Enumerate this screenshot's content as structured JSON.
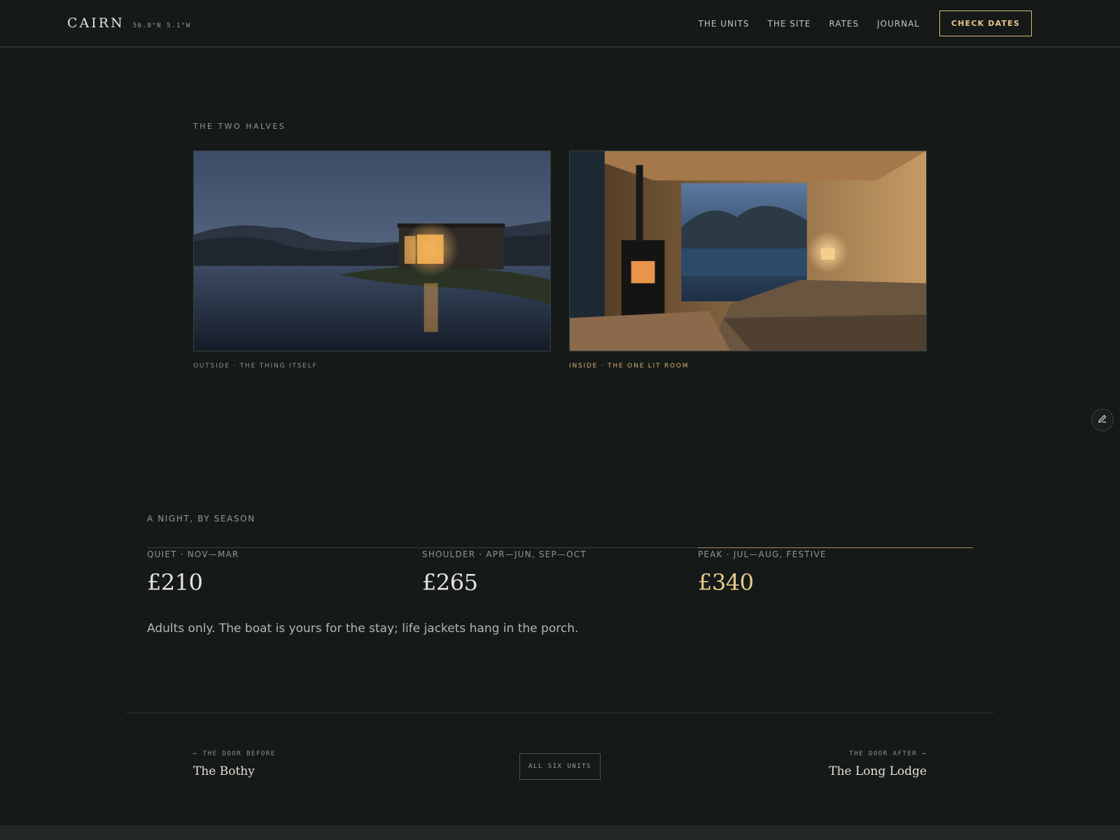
{
  "header": {
    "brand": "CAIRN",
    "coords": "56.8°N 5.1°W",
    "nav": [
      "THE UNITS",
      "THE SITE",
      "RATES",
      "JOURNAL"
    ],
    "cta": "CHECK DATES"
  },
  "halves": {
    "eyebrow": "THE TWO HALVES",
    "outside_caption": "OUTSIDE · THE THING ITSELF",
    "inside_caption": "INSIDE · THE ONE LIT ROOM"
  },
  "rates": {
    "eyebrow": "A NIGHT, BY SEASON",
    "seasons": [
      {
        "label": "QUIET · NOV—MAR",
        "price": "£210"
      },
      {
        "label": "SHOULDER · APR—JUN, SEP—OCT",
        "price": "£265"
      },
      {
        "label": "PEAK · JUL—AUG, FESTIVE",
        "price": "£340"
      }
    ],
    "note": "Adults only. The boat is yours for the stay; life jackets hang in the porch."
  },
  "pager": {
    "prev_label": "← THE DOOR BEFORE",
    "prev_name": "The Bothy",
    "all": "ALL SIX UNITS",
    "next_label": "THE DOOR AFTER →",
    "next_name": "The Long Lodge"
  },
  "colors": {
    "background": "#151a19",
    "accent": "#e8c98a"
  }
}
